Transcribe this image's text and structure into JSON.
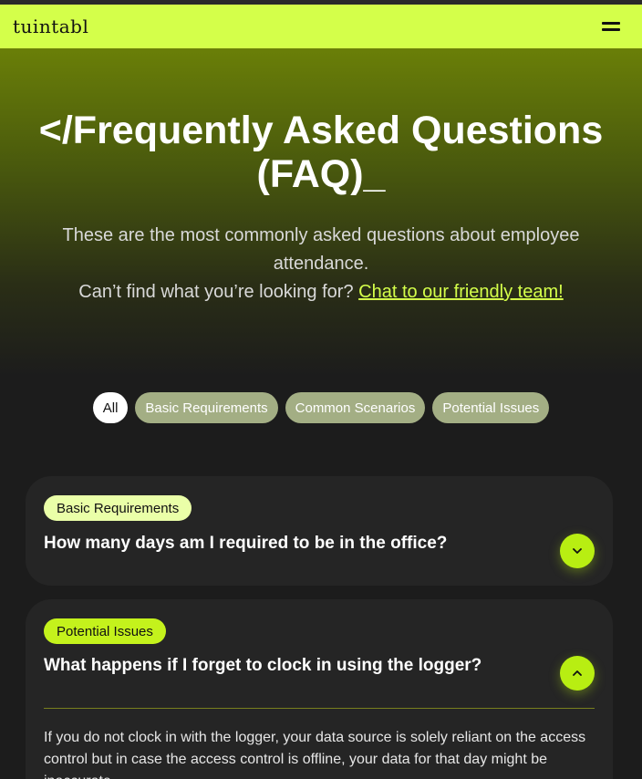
{
  "nav": {
    "logo": "tuintabl",
    "menu_icon": "hamburger-menu-icon"
  },
  "hero": {
    "title": "</Frequently Asked Questions (FAQ)_",
    "subtitle_line1": "These are the most commonly asked questions about employee attendance.",
    "subtitle_line2_prefix": "Can’t find what you’re looking for? ",
    "chat_link": "Chat to our friendly team!"
  },
  "filters": [
    "All",
    "Basic Requirements",
    "Common Scenarios",
    "Potential Issues"
  ],
  "faqs": [
    {
      "tag": "Basic Requirements",
      "question": "How many days am I required to be in the office?",
      "toggle_icon": "chevron-down-icon",
      "expanded": false
    },
    {
      "tag": "Potential Issues",
      "question": "What happens if I forget to clock in using the logger?",
      "toggle_icon": "chevron-up-icon",
      "expanded": true,
      "answer": "If you do not clock in with the logger, your data source is solely reliant on the access control but in case the access control is offline, your data for that day might be inaccurate."
    }
  ],
  "colors": {
    "accent": "#d4ff4a",
    "accent_bright": "#b8ee12",
    "background": "#1c1c1c",
    "card": "#252525"
  }
}
